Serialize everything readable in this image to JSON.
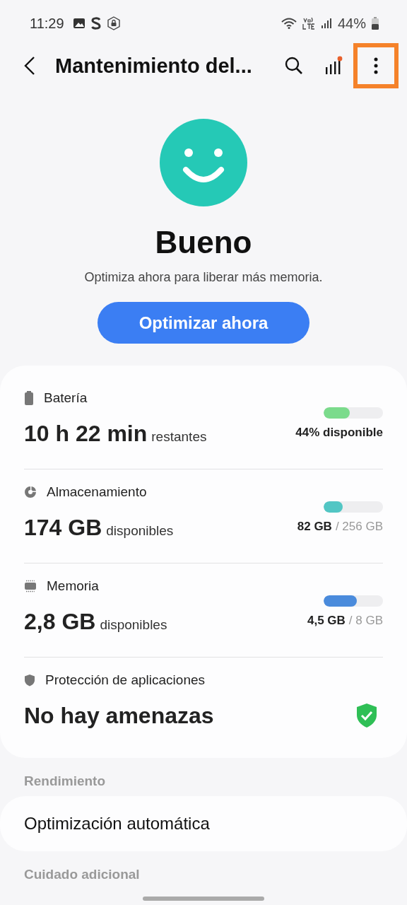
{
  "status_bar": {
    "time": "11:29",
    "battery": "44%"
  },
  "app_bar": {
    "title": "Mantenimiento del...",
    "more_button": {
      "highlighted": true
    }
  },
  "status": {
    "title": "Bueno",
    "subtitle": "Optimiza ahora para liberar más memoria.",
    "button": "Optimizar ahora"
  },
  "items": [
    {
      "kind": "meter",
      "label": "Batería",
      "value": "10 h 22 min",
      "suffix": "restantes",
      "level": 0.44,
      "color": "#7bdb8c",
      "reading": "44% disponible"
    },
    {
      "kind": "meter",
      "label": "Almacenamiento",
      "value": "174 GB",
      "suffix": "disponibles",
      "level": 0.32,
      "color": "#52c6c4",
      "reading": "82 GB",
      "total": "/ 256 GB"
    },
    {
      "kind": "meter",
      "label": "Memoria",
      "value": "2,8 GB",
      "suffix": "disponibles",
      "level": 0.56,
      "color": "#4a8bdc",
      "reading": "4,5 GB",
      "total": "/ 8 GB"
    },
    {
      "kind": "protection",
      "label": "Protección de aplicaciones",
      "value": "No hay amenazas"
    }
  ],
  "sections": [
    {
      "header": "Rendimiento",
      "rows": [
        "Optimización automática"
      ]
    },
    {
      "header": "Cuidado adicional"
    }
  ]
}
